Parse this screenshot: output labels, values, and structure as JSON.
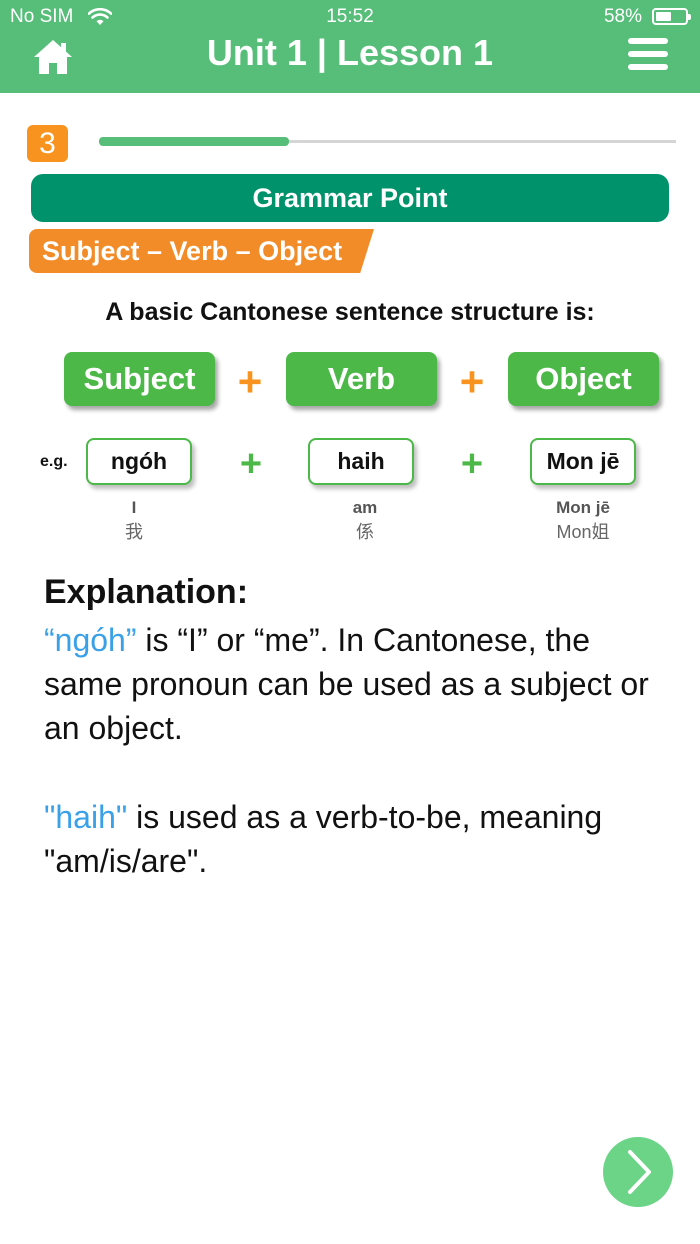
{
  "status_bar": {
    "carrier": "No SIM",
    "time": "15:52",
    "battery": "58%",
    "battery_level": 0.58
  },
  "header": {
    "title": "Unit 1 | Lesson 1"
  },
  "progress": {
    "step": "3",
    "fraction": 0.33
  },
  "grammar_banner": "Grammar Point",
  "topic_tag": "Subject – Verb – Object",
  "intro": "A basic Cantonese sentence structure is:",
  "structure": [
    "Subject",
    "Verb",
    "Object"
  ],
  "plus_sign": "+",
  "example": {
    "label": "e.g.",
    "words": [
      {
        "word": "ngóh",
        "english": "I",
        "chinese": "我"
      },
      {
        "word": "haih",
        "english": "am",
        "chinese": "係"
      },
      {
        "word": "Mon jē",
        "english": "Mon jē",
        "chinese": "Mon姐"
      }
    ]
  },
  "explanation": {
    "title": "Explanation:",
    "p1_highlight": "“ngóh”",
    "p1_text": " is “I” or “me”. In Cantonese, the same pronoun can be used as a subject or an object.",
    "p2_highlight": "\"haih\"",
    "p2_text": " is used as a verb-to-be, meaning \"am/is/are\"."
  },
  "colors": {
    "header": "#57BE7A",
    "banner": "#00936B",
    "accent_orange": "#F7931E",
    "green": "#4CB848",
    "highlight_blue": "#3AA0E8"
  },
  "icons": {
    "home": "home-icon",
    "menu": "menu-icon",
    "next": "chevron-right-icon",
    "wifi": "wifi-icon"
  }
}
